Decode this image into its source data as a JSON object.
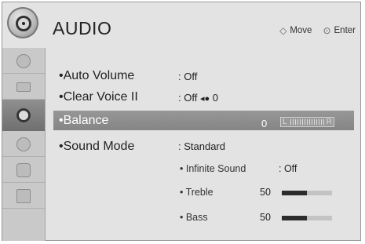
{
  "header": {
    "title": "AUDIO",
    "nav_move": "Move",
    "nav_enter": "Enter"
  },
  "sidebar": {
    "items": [
      {
        "icon": "picture-icon"
      },
      {
        "icon": "screen-icon"
      },
      {
        "icon": "audio-icon",
        "selected": true
      },
      {
        "icon": "clock-icon"
      },
      {
        "icon": "lock-icon"
      },
      {
        "icon": "option-icon"
      }
    ]
  },
  "settings": {
    "auto_volume": {
      "label": "•Auto Volume",
      "value": ": Off"
    },
    "clear_voice": {
      "label": "•Clear Voice II",
      "value": ": Off",
      "level": "0"
    },
    "balance": {
      "label": "•Balance",
      "value": "0",
      "left": "L",
      "right": "R"
    },
    "sound_mode": {
      "label": "•Sound Mode",
      "value": ": Standard",
      "infinite_sound": {
        "label": "• Infinite Sound",
        "value": ": Off"
      },
      "treble": {
        "label": "• Treble",
        "value": "50",
        "level": 0.5
      },
      "bass": {
        "label": "• Bass",
        "value": "50",
        "level": 0.5
      }
    }
  },
  "colors": {
    "selected_row": "#8e8e8e",
    "panel": "#e3e3e3",
    "bar_fill": "#2c2c2c"
  }
}
